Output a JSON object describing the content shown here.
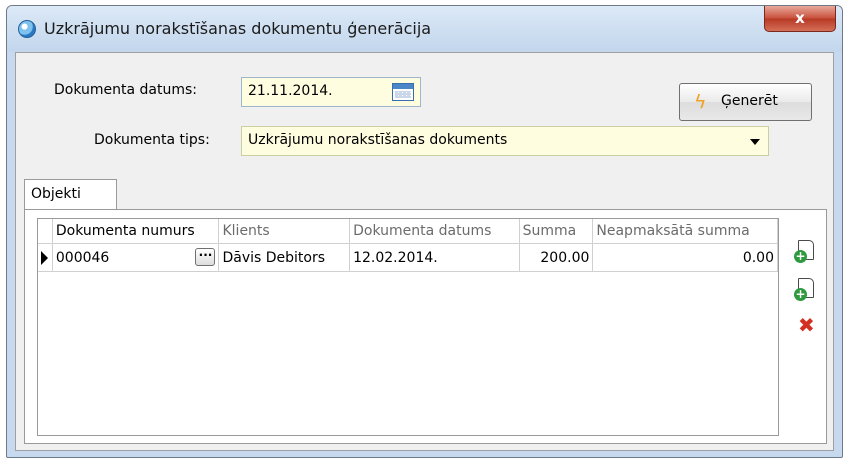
{
  "window": {
    "title": "Uzkrājumu norakstīšanas dokumentu ģenerācija",
    "close_label": "x"
  },
  "form": {
    "date_label": "Dokumenta datums:",
    "date_value": "21.11.2014.",
    "type_label": "Dokumenta tips:",
    "type_value": "Uzkrājumu norakstīšanas dokuments",
    "generate_label": "Ģenerēt"
  },
  "tabs": [
    {
      "label": "Objekti",
      "active": true
    }
  ],
  "grid": {
    "columns": [
      "Dokumenta numurs",
      "Klients",
      "Dokumenta datums",
      "Summa",
      "Neapmaksātā summa"
    ],
    "rows": [
      {
        "doc_number": "000046",
        "client": "Dāvis Debitors",
        "doc_date": "12.02.2014.",
        "sum": "200.00",
        "unpaid": "0.00"
      }
    ],
    "ellipsis": "···"
  },
  "side_buttons": {
    "icons": [
      "add-copy-document-icon",
      "add-document-icon",
      "delete-icon"
    ]
  },
  "colors": {
    "title_bar": "#c7d9ee",
    "input_bg": "#fffde0",
    "close_button": "#c9523e"
  }
}
